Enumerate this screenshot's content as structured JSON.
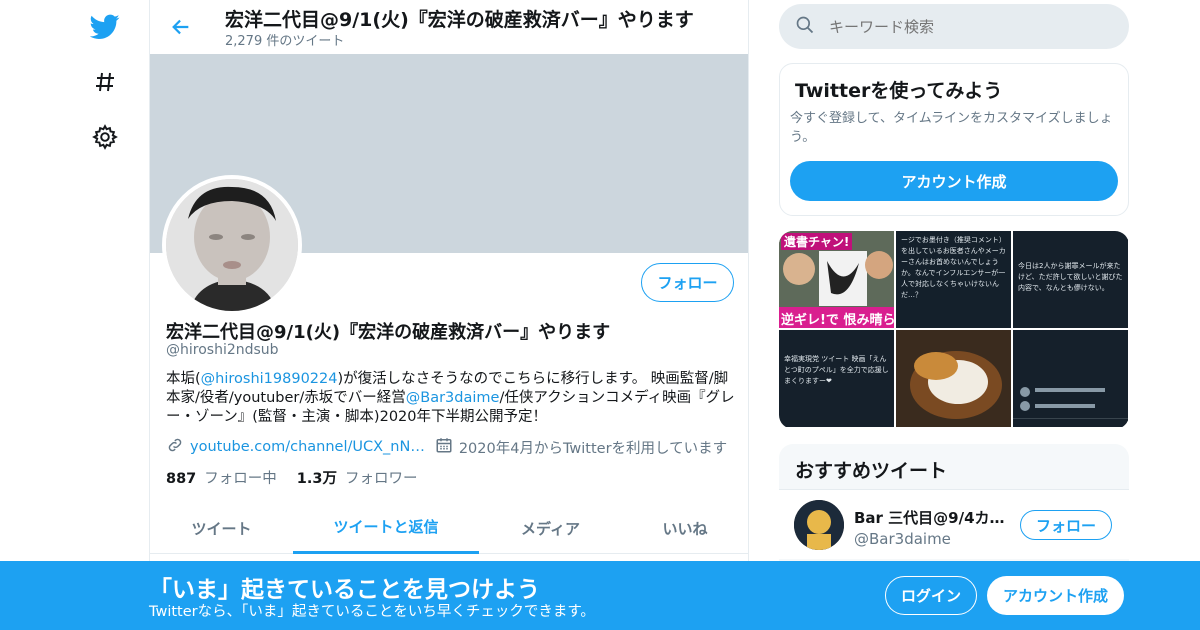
{
  "header": {
    "title": "宏洋二代目@9/1(火)『宏洋の破産救済バー』やります",
    "tweet_count": "2,279 件のツイート"
  },
  "profile": {
    "name": "宏洋二代目@9/1(火)『宏洋の破産救済バー』やります",
    "handle": "@hiroshi2ndsub",
    "follow_label": "フォロー",
    "bio": {
      "part1": "本垢(",
      "mention1": "@hiroshi19890224",
      "part2": ")が復活しなさそうなのでこちらに移行します。 映画監督/脚本家/役者/youtuber/赤坂でバー経営",
      "mention2": "@Bar3daime",
      "part3": "/任侠アクションコメディ映画『グレー・ゾーン』(監督・主演・脚本)2020年下半期公開予定！"
    },
    "url": "youtube.com/channel/UCX_nN…",
    "joined": "2020年4月からTwitterを利用しています",
    "following_count": "887",
    "following_label": "フォロー中",
    "followers_count": "1.3万",
    "followers_label": "フォロワー"
  },
  "tabs": [
    {
      "label": "ツイート",
      "active": false
    },
    {
      "label": "ツイートと返信",
      "active": true
    },
    {
      "label": "メディア",
      "active": false
    },
    {
      "label": "いいね",
      "active": false
    }
  ],
  "search": {
    "placeholder": "キーワード検索"
  },
  "signup_card": {
    "title": "Twitterを使ってみよう",
    "description": "今すぐ登録して、タイムラインをカスタマイズしましょう。",
    "button": "アカウント作成"
  },
  "media_grid": {
    "caption_1": "逆ギレ!で 恨み晴ら",
    "caption_1_top": "遺書チャン!",
    "caption_2": "ージでお墨付き（推奨コメント）を出しているお医者さんやメーカーさんはお首めないんでしょうか。なんでインフルエンサーが一人で対応しなくちゃいけないんだ…？",
    "caption_3": "今日は2人から謝罪メールが来たけど、ただ許して欲しいと謝びた内容で、なんとも儚けない。",
    "caption_4": "幸福実現党 ツイート 映画「えんとつ町のプペル」を全力で応援しまくりますー❤"
  },
  "recommend": {
    "title": "おすすめツイート",
    "name": "Bar 三代目@9/4カレ…",
    "handle": "@Bar3daime",
    "follow_label": "フォロー"
  },
  "bottom_bar": {
    "title": "「いま」起きていることを見つけよう",
    "subtitle": "Twitterなら、「いま」起きていることをいち早くチェックできます。",
    "login": "ログイン",
    "signup": "アカウント作成"
  },
  "colors": {
    "brand": "#1da1f2",
    "banner": "#ccd6dd",
    "muted_text": "#657786",
    "border": "#e6ecf0"
  },
  "icons": [
    "twitter-bird-icon",
    "hashtag-icon",
    "gear-icon",
    "back-arrow-icon",
    "link-icon",
    "calendar-icon",
    "search-icon"
  ]
}
